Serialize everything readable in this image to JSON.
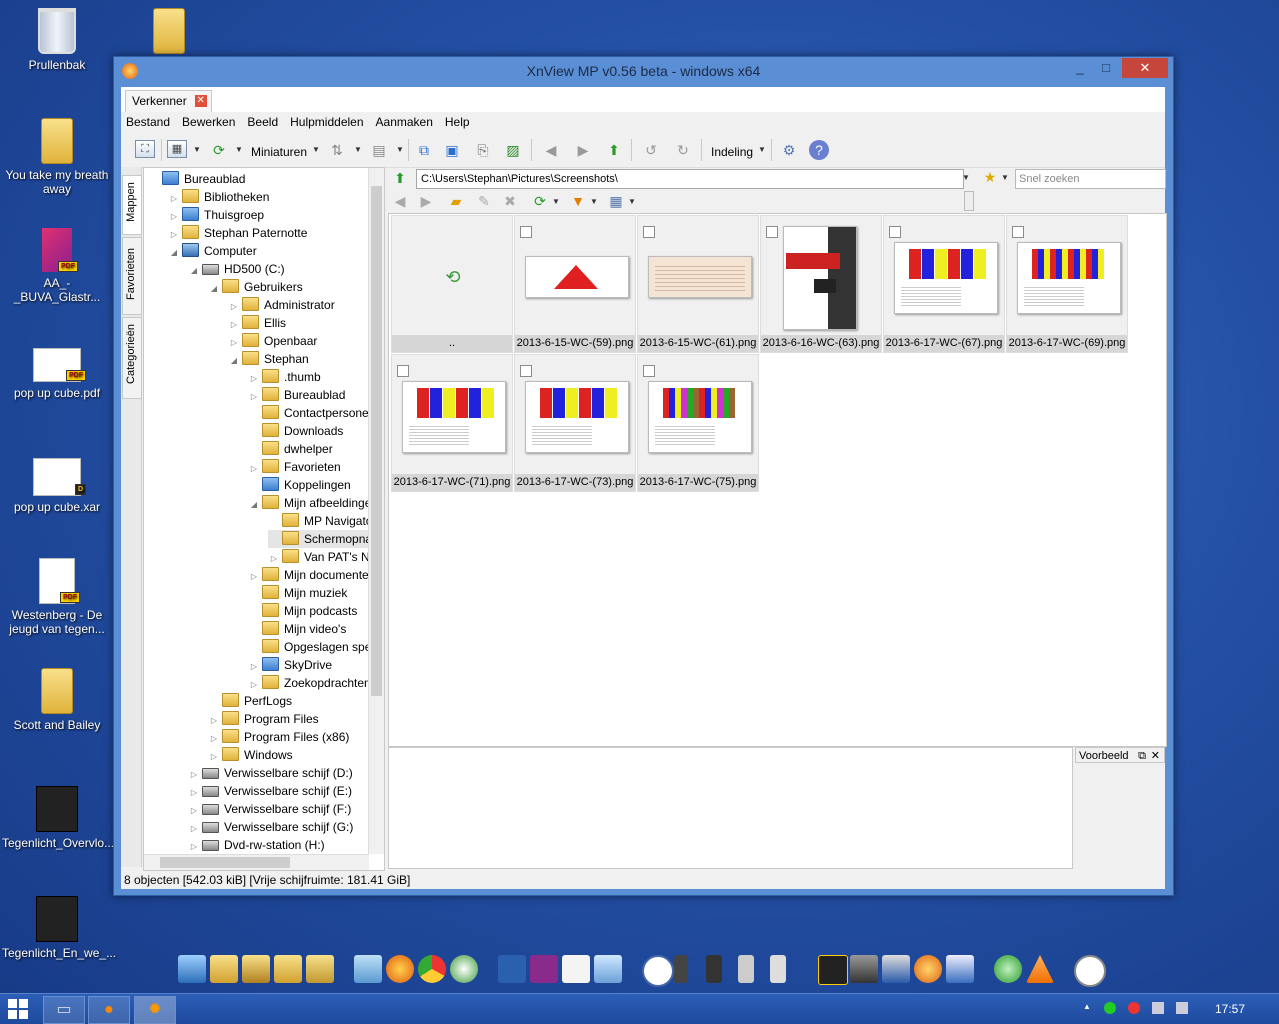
{
  "desktop": {
    "icons": [
      {
        "label": "Prullenbak"
      },
      {
        "label": ""
      },
      {
        "label": "You take my breath away"
      },
      {
        "label": "AA_-_BUVA_Glastr..."
      },
      {
        "label": "pop up cube.pdf"
      },
      {
        "label": "pop up cube.xar"
      },
      {
        "label": "Westenberg - De jeugd van tegen..."
      },
      {
        "label": "Scott and Bailey"
      },
      {
        "label": "Tegenlicht_Overvlo..."
      },
      {
        "label": "Tegenlicht_En_we_..."
      }
    ]
  },
  "window": {
    "title": "XnView MP v0.56 beta - windows x64",
    "min_glyph": "_",
    "max_glyph": "□",
    "close_glyph": "✕"
  },
  "tabs": [
    {
      "label": "Verkenner",
      "close": "✕"
    }
  ],
  "menu": [
    "Bestand",
    "Bewerken",
    "Beeld",
    "Hulpmiddelen",
    "Aanmaken",
    "Help"
  ],
  "toolbar": {
    "view_label": "Miniaturen",
    "layout_label": "Indeling"
  },
  "side_tabs": [
    "Mappen",
    "Favorieten",
    "Categorieën"
  ],
  "tree": [
    {
      "label": "Bureaublad",
      "level": 0,
      "exp": "",
      "icon": "blue"
    },
    {
      "label": "Bibliotheken",
      "level": 1,
      "exp": "▷",
      "icon": "folder"
    },
    {
      "label": "Thuisgroep",
      "level": 1,
      "exp": "▷",
      "icon": "blue"
    },
    {
      "label": "Stephan Paternotte",
      "level": 1,
      "exp": "▷",
      "icon": "folder"
    },
    {
      "label": "Computer",
      "level": 1,
      "exp": "◢",
      "icon": "pc"
    },
    {
      "label": "HD500 (C:)",
      "level": 2,
      "exp": "◢",
      "icon": "drive"
    },
    {
      "label": "Gebruikers",
      "level": 3,
      "exp": "◢",
      "icon": "folder"
    },
    {
      "label": "Administrator",
      "level": 4,
      "exp": "▷",
      "icon": "folder"
    },
    {
      "label": "Ellis",
      "level": 4,
      "exp": "▷",
      "icon": "folder"
    },
    {
      "label": "Openbaar",
      "level": 4,
      "exp": "▷",
      "icon": "folder"
    },
    {
      "label": "Stephan",
      "level": 4,
      "exp": "◢",
      "icon": "folder"
    },
    {
      "label": ".thumb",
      "level": 5,
      "exp": "▷",
      "icon": "folder"
    },
    {
      "label": "Bureaublad",
      "level": 5,
      "exp": "▷",
      "icon": "folder"
    },
    {
      "label": "Contactpersonen",
      "level": 5,
      "exp": "",
      "icon": "folder"
    },
    {
      "label": "Downloads",
      "level": 5,
      "exp": "",
      "icon": "folder"
    },
    {
      "label": "dwhelper",
      "level": 5,
      "exp": "",
      "icon": "folder"
    },
    {
      "label": "Favorieten",
      "level": 5,
      "exp": "▷",
      "icon": "folder"
    },
    {
      "label": "Koppelingen",
      "level": 5,
      "exp": "",
      "icon": "blue"
    },
    {
      "label": "Mijn afbeeldingen",
      "level": 5,
      "exp": "◢",
      "icon": "folder"
    },
    {
      "label": "MP Navigator E",
      "level": 6,
      "exp": "",
      "icon": "folder"
    },
    {
      "label": "Schermopnam",
      "level": 6,
      "exp": "",
      "icon": "folder",
      "selected": true
    },
    {
      "label": "Van PAT's NOK",
      "level": 6,
      "exp": "▷",
      "icon": "folder"
    },
    {
      "label": "Mijn documenten",
      "level": 5,
      "exp": "▷",
      "icon": "folder"
    },
    {
      "label": "Mijn muziek",
      "level": 5,
      "exp": "",
      "icon": "folder"
    },
    {
      "label": "Mijn podcasts",
      "level": 5,
      "exp": "",
      "icon": "folder"
    },
    {
      "label": "Mijn video's",
      "level": 5,
      "exp": "",
      "icon": "folder"
    },
    {
      "label": "Opgeslagen speller",
      "level": 5,
      "exp": "",
      "icon": "folder"
    },
    {
      "label": "SkyDrive",
      "level": 5,
      "exp": "▷",
      "icon": "blue"
    },
    {
      "label": "Zoekopdrachten",
      "level": 5,
      "exp": "▷",
      "icon": "folder"
    },
    {
      "label": "PerfLogs",
      "level": 3,
      "exp": "",
      "icon": "folder"
    },
    {
      "label": "Program Files",
      "level": 3,
      "exp": "▷",
      "icon": "folder"
    },
    {
      "label": "Program Files (x86)",
      "level": 3,
      "exp": "▷",
      "icon": "folder"
    },
    {
      "label": "Windows",
      "level": 3,
      "exp": "▷",
      "icon": "folder"
    },
    {
      "label": "Verwisselbare schijf (D:)",
      "level": 2,
      "exp": "▷",
      "icon": "drive"
    },
    {
      "label": "Verwisselbare schijf (E:)",
      "level": 2,
      "exp": "▷",
      "icon": "drive"
    },
    {
      "label": "Verwisselbare schijf (F:)",
      "level": 2,
      "exp": "▷",
      "icon": "drive"
    },
    {
      "label": "Verwisselbare schijf (G:)",
      "level": 2,
      "exp": "▷",
      "icon": "drive"
    },
    {
      "label": "Dvd-rw-station (H:)",
      "level": 2,
      "exp": "▷",
      "icon": "drive"
    }
  ],
  "address": {
    "path": "C:\\Users\\Stephan\\Pictures\\Screenshots\\",
    "search_placeholder": "Snel zoeken"
  },
  "thumbnails": [
    {
      "name": "..",
      "kind": "up"
    },
    {
      "name": "2013-6-15-WC-(59).png",
      "kind": "hist"
    },
    {
      "name": "2013-6-15-WC-(61).png",
      "kind": "table"
    },
    {
      "name": "2013-6-16-WC-(63).png",
      "kind": "poster"
    },
    {
      "name": "2013-6-17-WC-(67).png",
      "kind": "bars"
    },
    {
      "name": "2013-6-17-WC-(69).png",
      "kind": "bars2"
    },
    {
      "name": "2013-6-17-WC-(71).png",
      "kind": "bars"
    },
    {
      "name": "2013-6-17-WC-(73).png",
      "kind": "bars"
    },
    {
      "name": "2013-6-17-WC-(75).png",
      "kind": "bars3"
    }
  ],
  "preview": {
    "label": "Voorbeeld",
    "close": "✕"
  },
  "status": "8 objecten [542.03 kiB] [Vrije schijfruimte: 181.41 GiB]",
  "taskbar": {
    "clock": "17:57"
  },
  "colors": {
    "accent": "#5a8fd6",
    "close_red": "#c7463b"
  }
}
